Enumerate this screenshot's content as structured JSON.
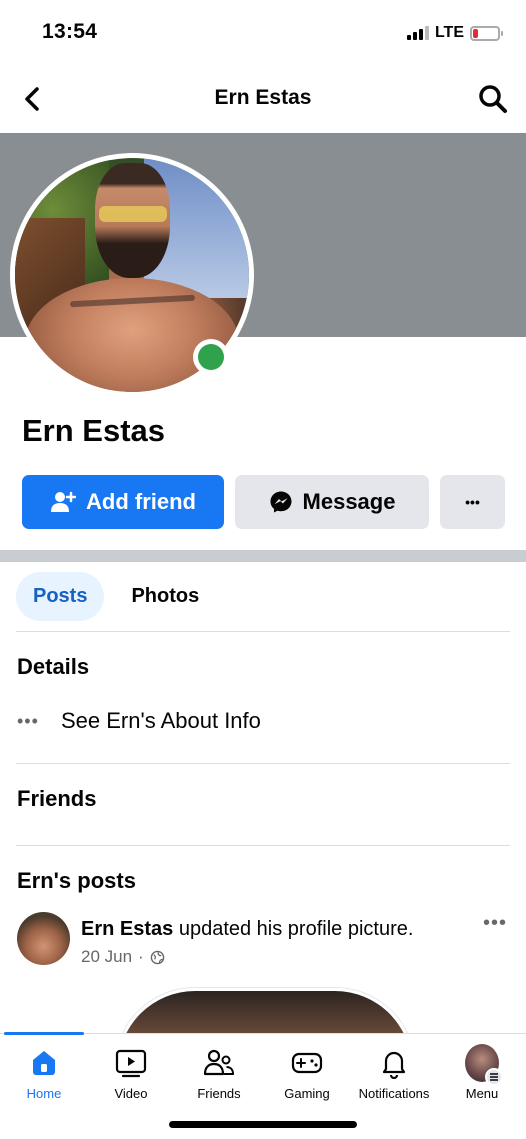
{
  "status_bar": {
    "time": "13:54",
    "network": "LTE"
  },
  "header": {
    "title": "Ern Estas"
  },
  "profile": {
    "name": "Ern Estas"
  },
  "actions": {
    "add_friend": "Add friend",
    "message": "Message",
    "more": "•••"
  },
  "tabs": [
    {
      "label": "Posts"
    },
    {
      "label": "Photos"
    }
  ],
  "details": {
    "title": "Details",
    "about_link": "See Ern's About Info"
  },
  "friends": {
    "title": "Friends"
  },
  "posts_section": {
    "title": "Ern's posts"
  },
  "post": {
    "author": "Ern Estas",
    "action": "updated his profile picture.",
    "date": "20 Jun",
    "separator": "·"
  },
  "bottom_nav": [
    {
      "label": "Home",
      "icon": "home-icon"
    },
    {
      "label": "Video",
      "icon": "video-icon"
    },
    {
      "label": "Friends",
      "icon": "friends-icon"
    },
    {
      "label": "Gaming",
      "icon": "gaming-icon"
    },
    {
      "label": "Notifications",
      "icon": "bell-icon"
    },
    {
      "label": "Menu",
      "icon": "menu-avatar"
    }
  ],
  "colors": {
    "accent": "#1877f2",
    "online": "#31a24c",
    "cover": "#898e93"
  }
}
